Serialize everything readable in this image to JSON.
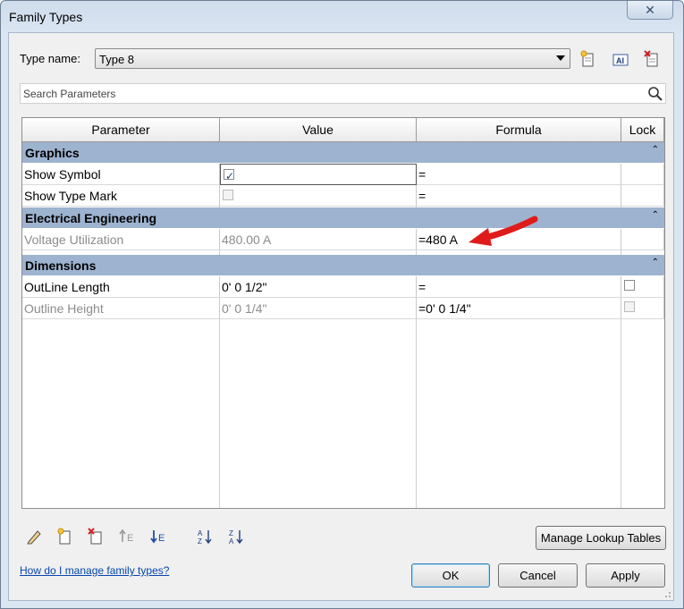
{
  "window": {
    "title": "Family Types",
    "close_label": "✕"
  },
  "type_row": {
    "label": "Type name:",
    "selected": "Type 8"
  },
  "search": {
    "placeholder": "Search Parameters"
  },
  "columns": {
    "parameter": "Parameter",
    "value": "Value",
    "formula": "Formula",
    "lock": "Lock"
  },
  "groups": {
    "graphics": "Graphics",
    "electrical": "Electrical Engineering",
    "dimensions": "Dimensions",
    "collapse_glyph": "⌃"
  },
  "rows": {
    "show_symbol": {
      "name": "Show Symbol",
      "formula": "="
    },
    "show_type_mark": {
      "name": "Show Type Mark",
      "formula": "="
    },
    "voltage": {
      "name": "Voltage Utilization",
      "value": "480.00 A",
      "formula": "=480 A"
    },
    "outline_length": {
      "name": "OutLine Length",
      "value": "0'  0 1/2\"",
      "formula": "="
    },
    "outline_height": {
      "name": "Outline Height",
      "value": "0'  0 1/4\"",
      "formula": "=0'  0 1/4\""
    }
  },
  "buttons": {
    "manage_lookup": "Manage Lookup Tables",
    "ok": "OK",
    "cancel": "Cancel",
    "apply": "Apply"
  },
  "help_link": "How do I manage family types?",
  "icons": [
    "new-type-icon",
    "rename-type-icon",
    "delete-type-icon",
    "edit-parameter-icon",
    "new-parameter-icon",
    "delete-parameter-icon",
    "move-up-icon",
    "move-down-icon",
    "sort-ascending-icon",
    "sort-descending-icon",
    "search-icon",
    "arrow-annotation"
  ],
  "colors": {
    "group_header": "#9db3cf",
    "annotation_arrow": "#e01b1b",
    "link": "#0645ad"
  }
}
